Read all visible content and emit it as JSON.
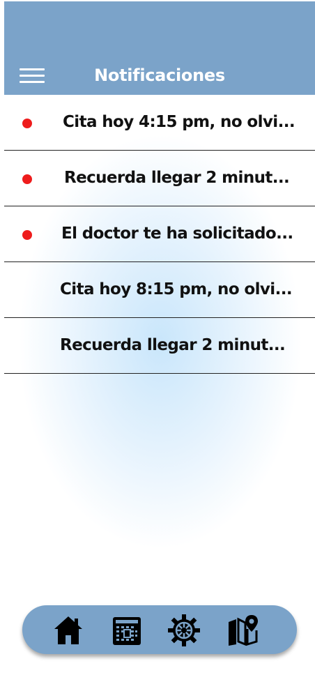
{
  "header": {
    "title": "Notificaciones",
    "menu_icon": "hamburger-menu-icon",
    "background_color": "#7ba3c9"
  },
  "notifications": [
    {
      "text": "Cita hoy 4:15 pm, no olvi...",
      "unread": true
    },
    {
      "text": "Recuerda llegar 2 minut...",
      "unread": true
    },
    {
      "text": "El doctor te ha solicitado...",
      "unread": true
    },
    {
      "text": "Cita hoy 8:15 pm, no olvi...",
      "unread": false
    },
    {
      "text": "Recuerda llegar 2 minut...",
      "unread": false
    }
  ],
  "colors": {
    "unread_dot": "#ee1c1c",
    "nav_background": "#7ba3c9"
  },
  "bottom_nav": {
    "items": [
      {
        "icon": "home-icon"
      },
      {
        "icon": "calendar-icon"
      },
      {
        "icon": "gear-icon"
      },
      {
        "icon": "map-pin-icon"
      }
    ]
  }
}
